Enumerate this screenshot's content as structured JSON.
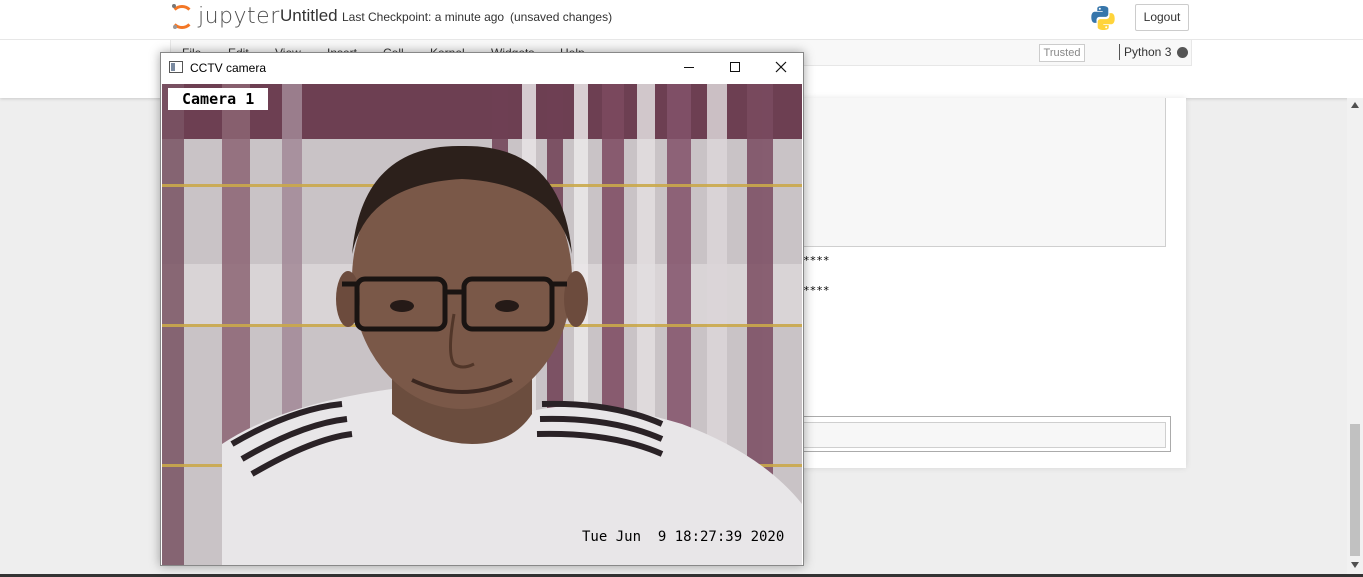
{
  "header": {
    "logo_text": "jupyter",
    "notebook_name": "Untitled",
    "checkpoint": "Last Checkpoint: a minute ago",
    "save_status": "(unsaved changes)",
    "logout_label": "Logout"
  },
  "menubar": {
    "items": [
      "File",
      "Edit",
      "View",
      "Insert",
      "Cell",
      "Kernel",
      "Widgets",
      "Help"
    ],
    "trusted_label": "Trusted",
    "kernel_name": "Python 3"
  },
  "notebook": {
    "output_line_1": "****",
    "output_line_2": "****"
  },
  "cctv_window": {
    "title": "CCTV camera",
    "camera_label": "Camera 1",
    "timestamp": "Tue Jun  9 18:27:39 2020"
  },
  "colors": {
    "jupyter_orange": "#f37726",
    "kernel_busy": "#555555"
  }
}
